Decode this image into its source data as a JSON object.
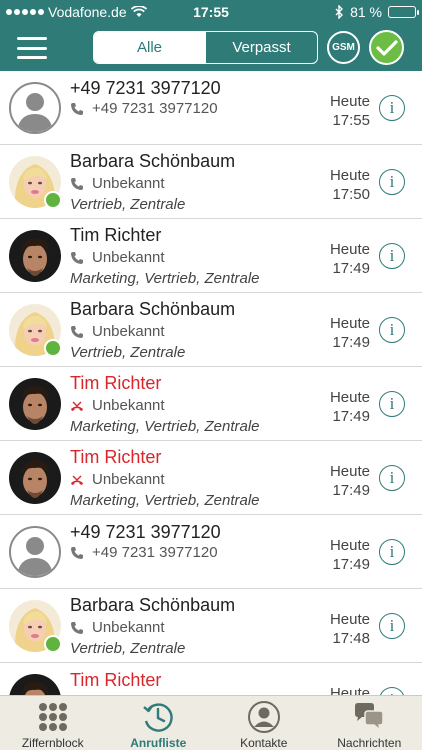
{
  "status_bar": {
    "carrier": "Vodafone.de",
    "time": "17:55",
    "battery_text": "81 %",
    "battery_level": 0.81
  },
  "nav": {
    "menu_icon": "hamburger-icon",
    "tabs": [
      {
        "label": "Alle",
        "active": true
      },
      {
        "label": "Verpasst",
        "active": false
      }
    ],
    "gsm_label": "GSM",
    "confirm_icon": "check-icon",
    "accent_color": "#2f7b78",
    "confirm_color": "#6dbd45"
  },
  "calls": [
    {
      "name": "+49 7231 3977120",
      "type": "normal",
      "detail": "+49 7231 3977120",
      "groups": "",
      "day": "Heute",
      "time": "17:55",
      "avatar": "placeholder",
      "online": false
    },
    {
      "name": "Barbara Schönbaum",
      "type": "normal",
      "detail": "Unbekannt",
      "groups": "Vertrieb, Zentrale",
      "day": "Heute",
      "time": "17:50",
      "avatar": "woman",
      "online": true
    },
    {
      "name": "Tim Richter",
      "type": "normal",
      "detail": "Unbekannt",
      "groups": "Marketing, Vertrieb, Zentrale",
      "day": "Heute",
      "time": "17:49",
      "avatar": "man",
      "online": false
    },
    {
      "name": "Barbara Schönbaum",
      "type": "normal",
      "detail": "Unbekannt",
      "groups": "Vertrieb, Zentrale",
      "day": "Heute",
      "time": "17:49",
      "avatar": "woman",
      "online": true
    },
    {
      "name": "Tim Richter",
      "type": "missed",
      "detail": "Unbekannt",
      "groups": "Marketing, Vertrieb, Zentrale",
      "day": "Heute",
      "time": "17:49",
      "avatar": "man",
      "online": false
    },
    {
      "name": "Tim Richter",
      "type": "missed",
      "detail": "Unbekannt",
      "groups": "Marketing, Vertrieb, Zentrale",
      "day": "Heute",
      "time": "17:49",
      "avatar": "man",
      "online": false
    },
    {
      "name": "+49 7231 3977120",
      "type": "normal",
      "detail": "+49 7231 3977120",
      "groups": "",
      "day": "Heute",
      "time": "17:49",
      "avatar": "placeholder",
      "online": false
    },
    {
      "name": "Barbara Schönbaum",
      "type": "normal",
      "detail": "Unbekannt",
      "groups": "Vertrieb, Zentrale",
      "day": "Heute",
      "time": "17:48",
      "avatar": "woman",
      "online": true
    },
    {
      "name": "Tim Richter",
      "type": "missed",
      "detail": "",
      "groups": "",
      "day": "Heute",
      "time": "",
      "avatar": "man",
      "online": false
    }
  ],
  "tab_bar": [
    {
      "label": "Ziffernblock",
      "icon": "keypad-icon",
      "active": false
    },
    {
      "label": "Anrufliste",
      "icon": "call-history-icon",
      "active": true
    },
    {
      "label": "Kontakte",
      "icon": "contacts-icon",
      "active": false
    },
    {
      "label": "Nachrichten",
      "icon": "messages-icon",
      "active": false
    }
  ],
  "colors": {
    "missed": "#d8262b",
    "online": "#5fb33f",
    "tab_bar_bg": "#eeebe3"
  }
}
